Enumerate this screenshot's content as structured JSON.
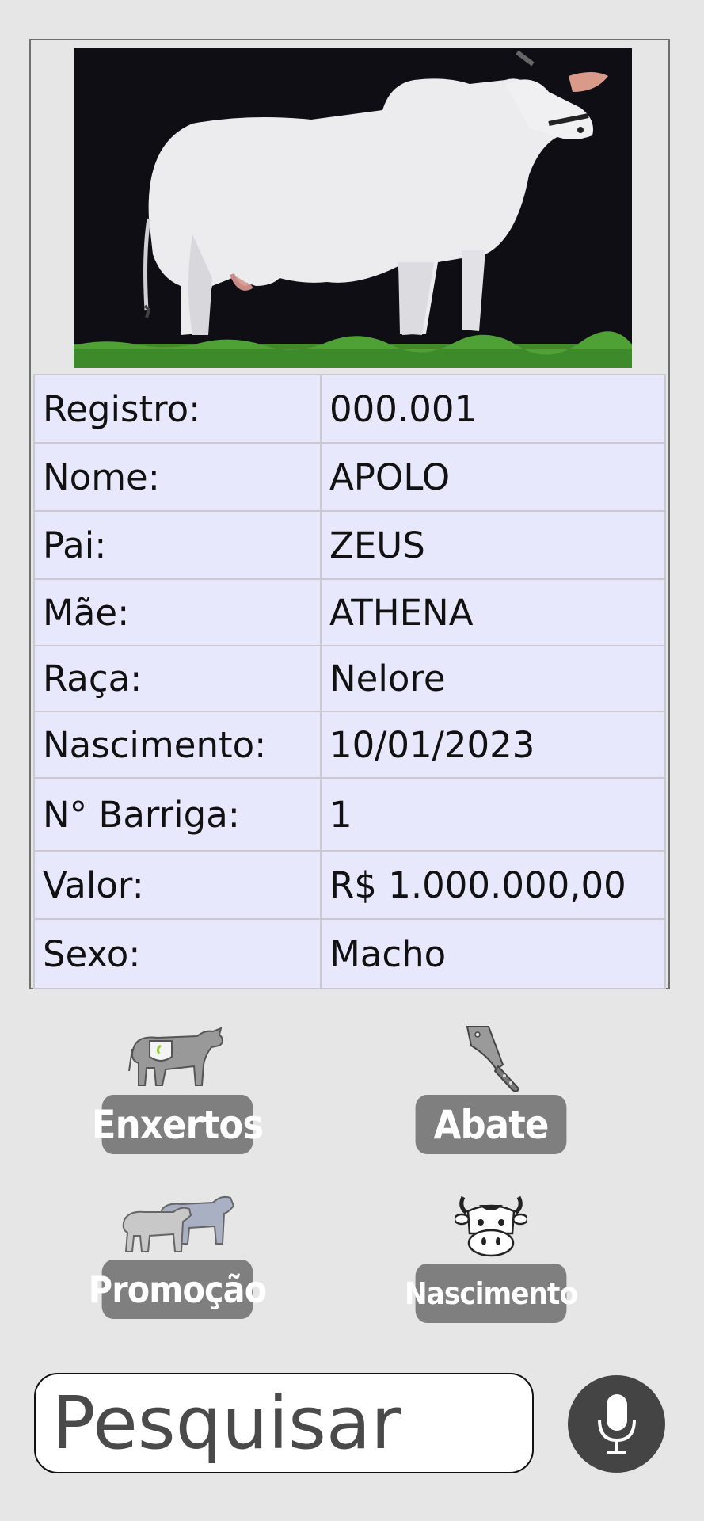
{
  "animal": {
    "photo_icon": "white-nelore-bull-photo",
    "rows": [
      {
        "label": "Registro:",
        "value": "000.001"
      },
      {
        "label": "Nome:",
        "value": "APOLO"
      },
      {
        "label": "Pai:",
        "value": "ZEUS"
      },
      {
        "label": "Mãe:",
        "value": "ATHENA"
      },
      {
        "label": "Raça:",
        "value": "Nelore"
      },
      {
        "label": "Nascimento:",
        "value": "10/01/2023"
      },
      {
        "label": "N° Barriga:",
        "value": "1"
      },
      {
        "label": "Valor:",
        "value": "R$ 1.000.000,00"
      },
      {
        "label": "Sexo:",
        "value": "Macho"
      }
    ]
  },
  "actions": {
    "enxertos": {
      "label": "Enxertos",
      "icon": "cow-graft-icon"
    },
    "abate": {
      "label": "Abate",
      "icon": "cleaver-icon"
    },
    "promocao": {
      "label": "Promoção",
      "icon": "herd-icon"
    },
    "nascimento": {
      "label": "Nascimento",
      "icon": "cow-face-icon"
    }
  },
  "search": {
    "placeholder": "Pesquisar",
    "mic_icon": "microphone-icon"
  },
  "colors": {
    "button": "#7f7f7f",
    "table_cell": "#e8e8fd",
    "background": "#e6e6e6",
    "mic": "#444444"
  }
}
